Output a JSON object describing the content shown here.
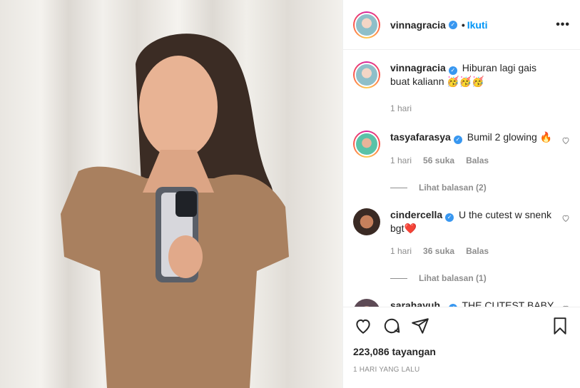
{
  "header": {
    "username": "vinnagracia",
    "separator": "•",
    "follow_label": "Ikuti",
    "more_label": "•••"
  },
  "caption": {
    "username": "vinnagracia",
    "text": "Hiburan lagi gais buat kaliann 🥳🥳🥳",
    "time": "1 hari"
  },
  "comments": [
    {
      "username": "tasyafarasya",
      "text": "Bumil 2 glowing 🔥",
      "time": "1 hari",
      "likes": "56 suka",
      "reply_label": "Balas",
      "view_replies": "Lihat balasan (2)"
    },
    {
      "username": "cindercella",
      "text": "U the cutest w snenk bgt❤️",
      "time": "1 hari",
      "likes": "36 suka",
      "reply_label": "Balas",
      "view_replies": "Lihat balasan (1)"
    },
    {
      "username": "sarahayuh_",
      "text": "THE CUTEST BABY"
    }
  ],
  "footer": {
    "views": "223,086 tayangan",
    "posted": "1 HARI YANG LALU"
  },
  "icons": [
    "heart-icon",
    "comment-icon",
    "share-icon",
    "bookmark-icon",
    "verified-icon",
    "more-icon"
  ],
  "colors": {
    "link": "#0095f6",
    "verified": "#3897f0",
    "muted": "#8e8e8e",
    "text": "#262626"
  }
}
